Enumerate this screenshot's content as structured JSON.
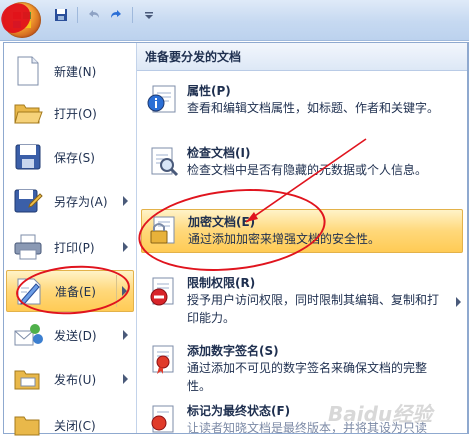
{
  "quick_access": {
    "icons": [
      "save-icon",
      "undo-icon",
      "redo-icon",
      "customize-dropdown-icon"
    ]
  },
  "left_menu": {
    "items": [
      {
        "label": "新建(N)",
        "icon": "new-document-icon",
        "submenu": false
      },
      {
        "label": "打开(O)",
        "icon": "open-folder-icon",
        "submenu": false
      },
      {
        "label": "保存(S)",
        "icon": "save-disk-icon",
        "submenu": false
      },
      {
        "label": "另存为(A)",
        "icon": "save-as-icon",
        "submenu": true
      },
      {
        "label": "打印(P)",
        "icon": "printer-icon",
        "submenu": true
      },
      {
        "label": "准备(E)",
        "icon": "prepare-icon",
        "submenu": true,
        "active": true
      },
      {
        "label": "发送(D)",
        "icon": "send-icon",
        "submenu": true
      },
      {
        "label": "发布(U)",
        "icon": "publish-icon",
        "submenu": true
      },
      {
        "label": "关闭(C)",
        "icon": "close-folder-icon",
        "submenu": false
      }
    ]
  },
  "right_panel": {
    "header": "准备要分发的文档",
    "items": [
      {
        "title": "属性(P)",
        "desc": "查看和编辑文档属性，如标题、作者和关键字。",
        "icon": "properties-icon"
      },
      {
        "title": "检查文档(I)",
        "desc": "检查文档中是否有隐藏的元数据或个人信息。",
        "icon": "inspect-document-icon"
      },
      {
        "title": "加密文档(E)",
        "desc": "通过添加加密来增强文档的安全性。",
        "icon": "encrypt-document-icon",
        "highlight": true
      },
      {
        "title": "限制权限(R)",
        "desc": "授予用户访问权限，同时限制其编辑、复制和打印能力。",
        "icon": "restrict-permission-icon",
        "submenu": true
      },
      {
        "title": "添加数字签名(S)",
        "desc": "通过添加不可见的数字签名来确保文档的完整性。",
        "icon": "digital-signature-icon"
      },
      {
        "title": "标记为最终状态(F)",
        "desc": "让读者知晓文档是最终版本，并将其设为只读",
        "icon": "mark-final-icon"
      }
    ]
  },
  "watermark": "Baidu经验",
  "colors": {
    "highlight": "#ffd87a",
    "annotation": "#e0141e",
    "border": "#8fa9cf"
  }
}
